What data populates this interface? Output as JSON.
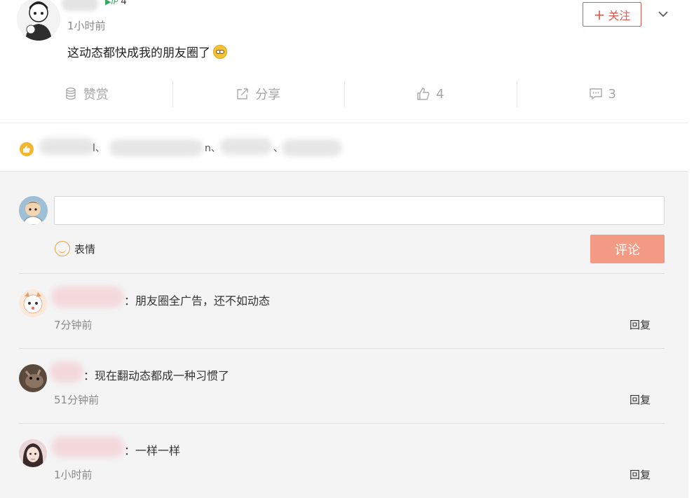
{
  "post": {
    "level_text": "4",
    "time": "1小时前",
    "follow_label": "关注",
    "text": "这动态都快成我的朋友圈了",
    "actions": {
      "reward": "赞赏",
      "share": "分享",
      "like_count": "4",
      "comment_count": "3"
    }
  },
  "likes": {
    "fragments": [
      "l、",
      "n、",
      "、"
    ]
  },
  "composer": {
    "emoji_label": "表情",
    "submit_label": "评论"
  },
  "comments": [
    {
      "text": "：朋友圈全广告，还不如动态",
      "time": "7分钟前",
      "reply": "回复"
    },
    {
      "text": "：现在翻动态都成一种习惯了",
      "time": "51分钟前",
      "reply": "回复"
    },
    {
      "text": "：一样一样",
      "time": "1小时前",
      "reply": "回复"
    }
  ],
  "colors": {
    "accent": "#e2594e",
    "submit_bg": "#f29a84",
    "like_badge": "#f5b52e",
    "comments_bg": "#f4f4f4"
  }
}
